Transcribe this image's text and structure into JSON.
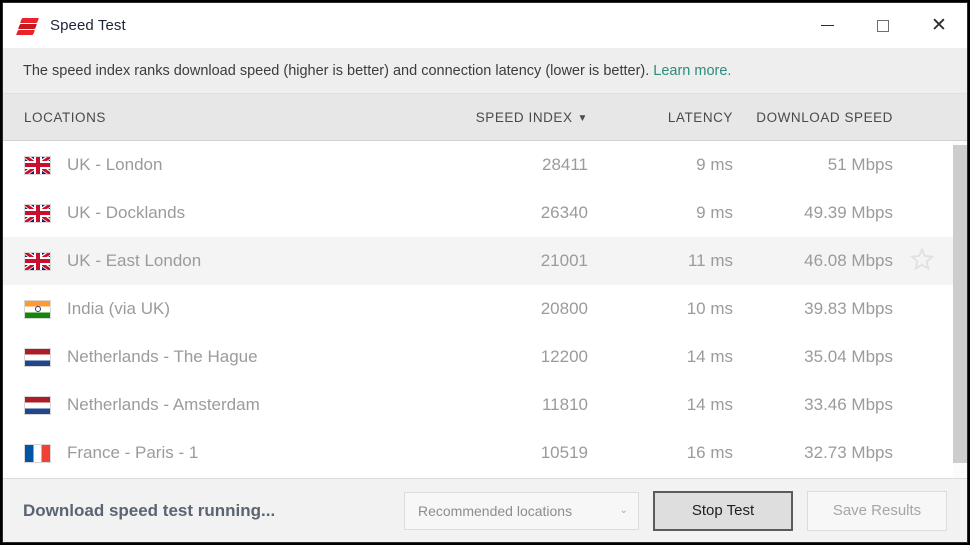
{
  "window": {
    "title": "Speed Test",
    "icon": "layers-icon",
    "controls": {
      "minimize": "minimize-icon",
      "maximize": "maximize-icon",
      "close": "close-icon"
    }
  },
  "infobar": {
    "text": "The speed index ranks download speed (higher is better) and connection latency (lower is better).",
    "link": "Learn more."
  },
  "table": {
    "headers": {
      "locations": "LOCATIONS",
      "speed_index": "SPEED INDEX",
      "sort_arrow": "▼",
      "latency": "LATENCY",
      "download_speed": "DOWNLOAD SPEED"
    },
    "rows": [
      {
        "flag": "uk",
        "name": "UK - London",
        "speed_index": "28411",
        "latency": "9 ms",
        "download": "51 Mbps",
        "hover": false
      },
      {
        "flag": "uk",
        "name": "UK - Docklands",
        "speed_index": "26340",
        "latency": "9 ms",
        "download": "49.39 Mbps",
        "hover": false
      },
      {
        "flag": "uk",
        "name": "UK - East London",
        "speed_index": "21001",
        "latency": "11 ms",
        "download": "46.08 Mbps",
        "hover": true
      },
      {
        "flag": "in",
        "name": "India (via UK)",
        "speed_index": "20800",
        "latency": "10 ms",
        "download": "39.83 Mbps",
        "hover": false
      },
      {
        "flag": "nl",
        "name": "Netherlands - The Hague",
        "speed_index": "12200",
        "latency": "14 ms",
        "download": "35.04 Mbps",
        "hover": false
      },
      {
        "flag": "nl",
        "name": "Netherlands - Amsterdam",
        "speed_index": "11810",
        "latency": "14 ms",
        "download": "33.46 Mbps",
        "hover": false
      },
      {
        "flag": "fr",
        "name": "France - Paris - 1",
        "speed_index": "10519",
        "latency": "16 ms",
        "download": "32.73 Mbps",
        "hover": false
      }
    ],
    "favorite_icon": "star-outline-icon"
  },
  "footer": {
    "status": "Download speed test running...",
    "dropdown": {
      "value": "Recommended locations",
      "caret": "⌄"
    },
    "stop_button": "Stop Test",
    "save_button": "Save Results"
  },
  "colors": {
    "link": "#2e8b7a",
    "status_text": "#5a6472",
    "row_text": "#9b9b9b",
    "hover_row": "#f4f4f4",
    "header_bg": "#e7e7e7",
    "infobar_bg": "#eeeeee",
    "footer_bg": "#f2f2f2",
    "accent_red": "#e8242a"
  }
}
